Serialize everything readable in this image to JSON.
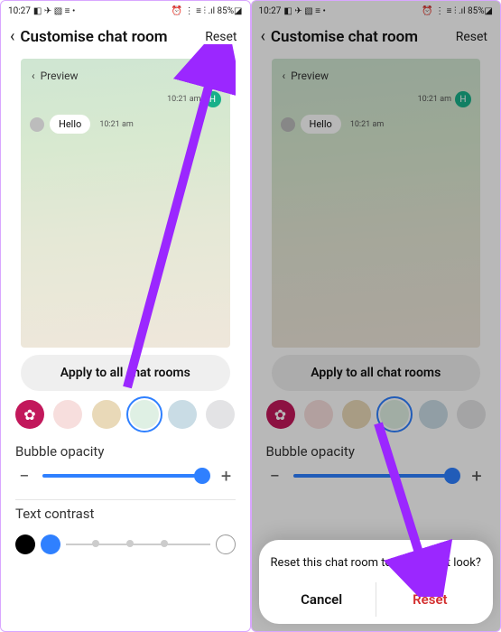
{
  "status": {
    "time": "10:27",
    "left_icons": "◧ ✈ ▧ ≡ •",
    "right_icons": "⏰ ⋮ ≡ ⫶ .ıl 85%◪",
    "battery": "85%"
  },
  "header": {
    "title": "Customise chat room",
    "reset": "Reset"
  },
  "preview": {
    "label": "Preview",
    "outgoing_time": "10:21 am",
    "outgoing_avatar": "H",
    "incoming_text": "Hello",
    "incoming_time": "10:21 am"
  },
  "apply_button": "Apply to all chat rooms",
  "swatches": [
    {
      "name": "theme-picker",
      "color": "#c2185b",
      "flower": true
    },
    {
      "name": "swatch-pink",
      "color": "#f7dedd"
    },
    {
      "name": "swatch-tan",
      "color": "#e9d9b8"
    },
    {
      "name": "swatch-mint",
      "color": "#dff0e4",
      "selected": true
    },
    {
      "name": "swatch-blue",
      "color": "#c9dce5"
    },
    {
      "name": "swatch-grey",
      "color": "#e3e3e5"
    }
  ],
  "opacity": {
    "label": "Bubble opacity",
    "minus": "−",
    "plus": "+"
  },
  "contrast": {
    "label": "Text contrast"
  },
  "dialog": {
    "message": "Reset this chat room to the default look?",
    "cancel": "Cancel",
    "reset": "Reset"
  }
}
